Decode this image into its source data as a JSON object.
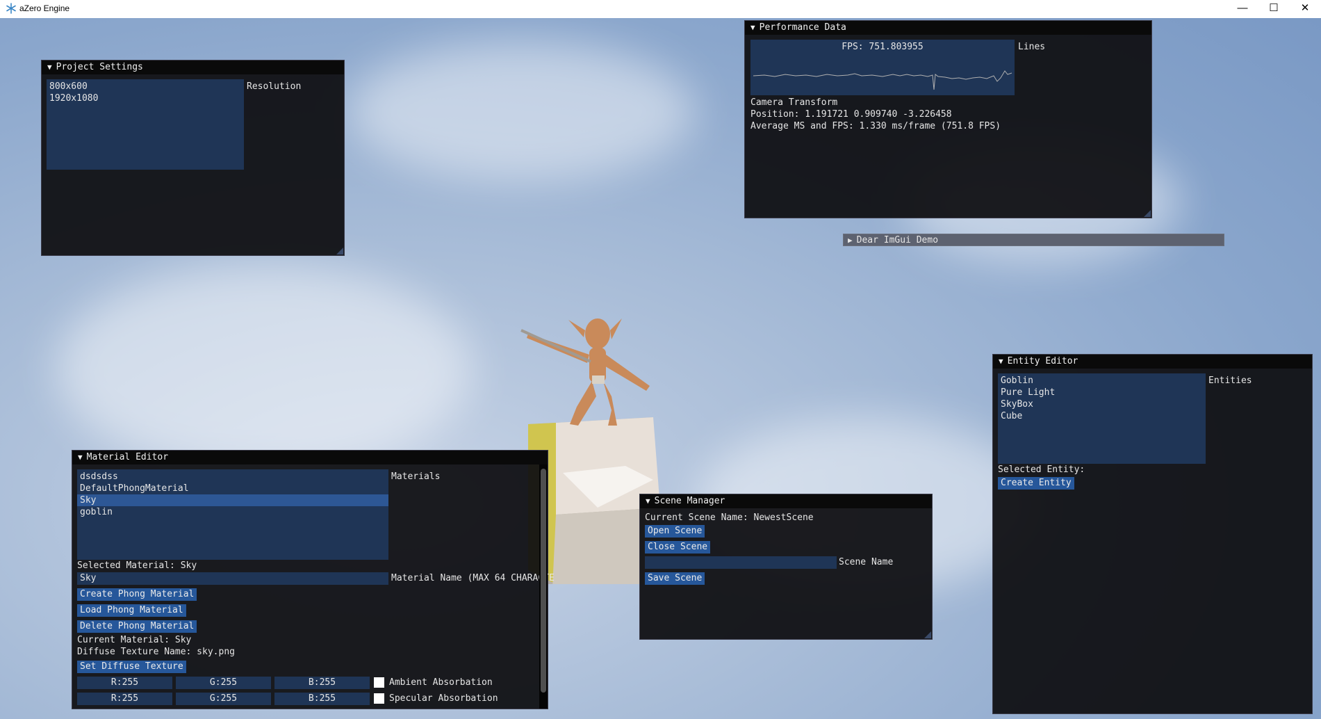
{
  "titlebar": {
    "title": "aZero Engine",
    "minimize_icon": "—",
    "maximize_icon": "☐",
    "close_icon": "✕"
  },
  "project_settings": {
    "title": "Project Settings",
    "resolutions": [
      "800x600",
      "1920x1080"
    ],
    "resolution_label": "Resolution"
  },
  "performance": {
    "title": "Performance Data",
    "fps_overlay": "FPS: 751.803955",
    "plot_label": "Lines",
    "camera_label": "Camera Transform",
    "position": "Position: 1.191721 0.909740 -3.226458",
    "average": "Average MS and FPS: 1.330 ms/frame (751.8 FPS)"
  },
  "imgui_demo": {
    "title": "Dear ImGui Demo"
  },
  "entity_editor": {
    "title": "Entity Editor",
    "entities": [
      "Goblin",
      "Pure Light",
      "SkyBox",
      "Cube"
    ],
    "entities_label": "Entities",
    "selected_label": "Selected Entity:",
    "create_button": "Create Entity"
  },
  "material_editor": {
    "title": "Material Editor",
    "materials": [
      "dsdsdss",
      "DefaultPhongMaterial",
      "Sky",
      "goblin"
    ],
    "selected_index": 2,
    "materials_label": "Materials",
    "selected_material": "Selected Material: Sky",
    "name_value": "Sky",
    "name_label": "Material Name (MAX 64 CHARACTE",
    "create_button": "Create Phong Material",
    "load_button": "Load Phong Material",
    "delete_button": "Delete Phong Material",
    "current_material": "Current Material: Sky",
    "diffuse_texture": "Diffuse Texture Name: sky.png",
    "set_diffuse_button": "Set Diffuse Texture",
    "ambient": {
      "r": "R:255",
      "g": "G:255",
      "b": "B:255",
      "label": "Ambient Absorbation",
      "color": "#ffffff"
    },
    "specular": {
      "r": "R:255",
      "g": "G:255",
      "b": "B:255",
      "label": "Specular Absorbation",
      "color": "#ffffff"
    }
  },
  "scene_manager": {
    "title": "Scene Manager",
    "current_scene": "Current Scene Name: NewestScene",
    "open_button": "Open Scene",
    "close_button": "Close Scene",
    "scene_name_value": "",
    "scene_name_label": "Scene Name",
    "save_button": "Save Scene"
  },
  "colors": {
    "window_bg": "#0f0f12",
    "button": "#26579a",
    "frame": "#1f3556",
    "selected": "#2d5795",
    "title_bg": "#0a0a0a"
  }
}
